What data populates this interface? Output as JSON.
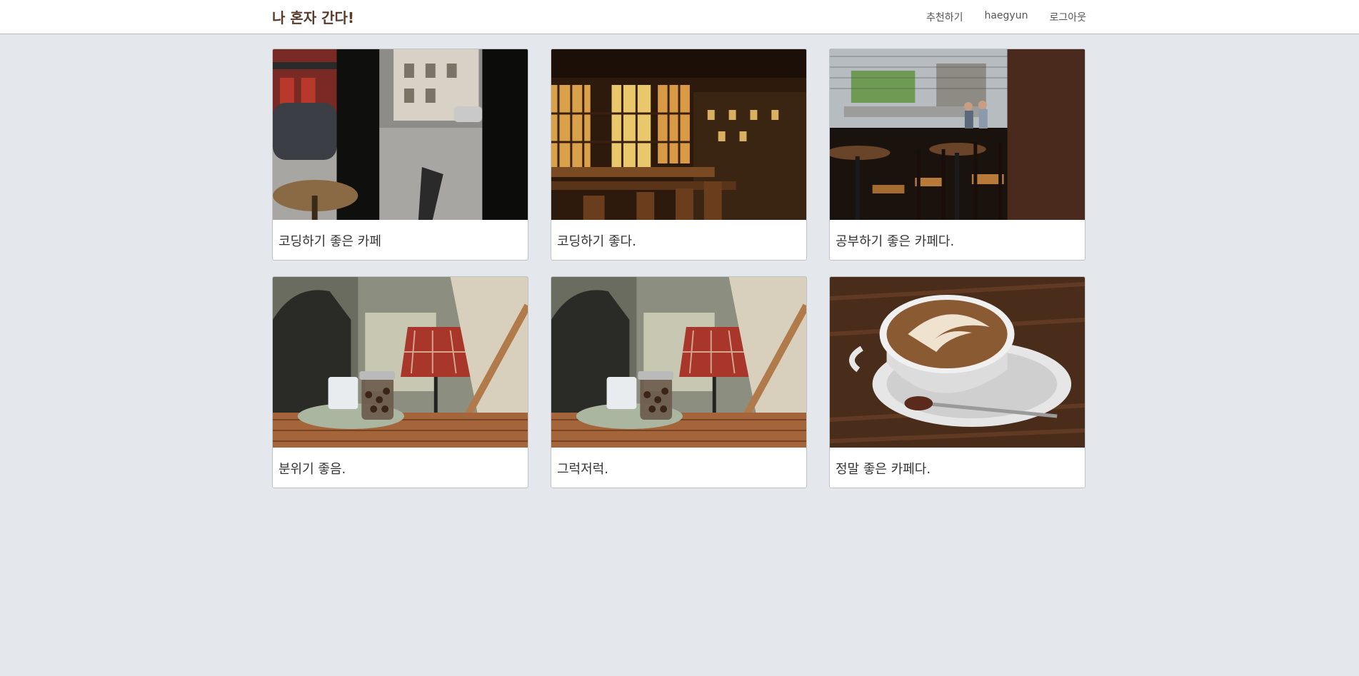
{
  "header": {
    "brand": "나 혼자 간다!",
    "nav": [
      {
        "label": "추천하기"
      },
      {
        "label": "haegyun"
      },
      {
        "label": "로그아웃"
      }
    ]
  },
  "cards": [
    {
      "title": "코딩하기 좋은 카페",
      "image": "street-view-cafe-window-photo"
    },
    {
      "title": "코딩하기 좋다.",
      "image": "wooden-cafe-interior-photo"
    },
    {
      "title": "공부하기 좋은 카페다.",
      "image": "cafe-chairs-window-photo"
    },
    {
      "title": "분위기 좋음.",
      "image": "lamp-coffee-jar-photo"
    },
    {
      "title": "그럭저럭.",
      "image": "lamp-coffee-jar-photo"
    },
    {
      "title": "정말 좋은 카페다.",
      "image": "latte-art-cup-photo"
    }
  ]
}
